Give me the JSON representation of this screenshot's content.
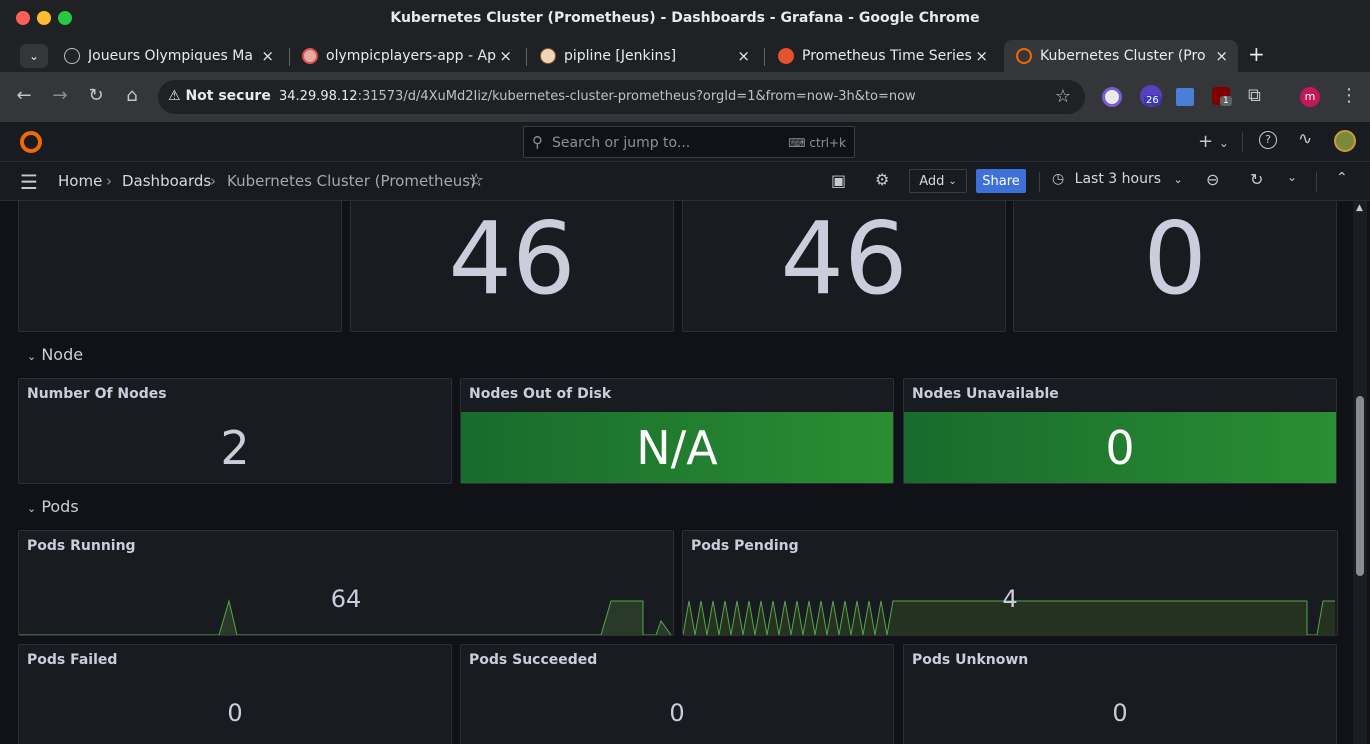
{
  "window": {
    "title": "Kubernetes Cluster (Prometheus) - Dashboards - Grafana - Google Chrome",
    "traffic_lights": [
      "#ff5f57",
      "#febc2e",
      "#28c840"
    ]
  },
  "tabs": [
    {
      "label": "Joueurs Olympiques Ma",
      "icon": "globe-icon",
      "active": false
    },
    {
      "label": "olympicplayers-app - Ap",
      "icon": "app-icon",
      "active": false
    },
    {
      "label": "pipline [Jenkins]",
      "icon": "jenkins-icon",
      "active": false
    },
    {
      "label": "Prometheus Time Series",
      "icon": "prometheus-icon",
      "active": false
    },
    {
      "label": "Kubernetes Cluster (Pro",
      "icon": "grafana-icon",
      "active": true
    }
  ],
  "tab_close": "×",
  "new_tab": "+",
  "omnibox": {
    "security": "Not secure",
    "host": "34.29.98.12",
    "path": ":31573/d/4XuMd2Iiz/kubernetes-cluster-prometheus?orgId=1&from=now-3h&to=now"
  },
  "extensions": {
    "badge_26": "26",
    "badge_1": "1",
    "profile_initial": "m"
  },
  "grafana": {
    "search_placeholder": "Search or jump to...",
    "search_shortcut": "ctrl+k",
    "breadcrumb": [
      "Home",
      "Dashboards",
      "Kubernetes Cluster (Prometheus)"
    ],
    "breadcrumb_sep": "›",
    "add_label": "Add",
    "share_label": "Share",
    "time_range": "Last 3 hours",
    "accent": "#3d71d9",
    "brand": "#f46800"
  },
  "top_stats": [
    {
      "value": ""
    },
    {
      "value": "46"
    },
    {
      "value": "46"
    },
    {
      "value": "0"
    }
  ],
  "rows": {
    "node": "Node",
    "pods": "Pods"
  },
  "node_panels": [
    {
      "title": "Number Of Nodes",
      "value": "2",
      "color": "none"
    },
    {
      "title": "Nodes Out of Disk",
      "value": "N/A",
      "color": "#2a8e33"
    },
    {
      "title": "Nodes Unavailable",
      "value": "0",
      "color": "#2a8e33"
    }
  ],
  "pods_panels": [
    {
      "title": "Pods Running",
      "value": "64"
    },
    {
      "title": "Pods Pending",
      "value": "4"
    }
  ],
  "pods_bottom": [
    {
      "title": "Pods Failed",
      "value": "0"
    },
    {
      "title": "Pods Succeeded",
      "value": "0"
    },
    {
      "title": "Pods Unknown",
      "value": "0"
    }
  ]
}
